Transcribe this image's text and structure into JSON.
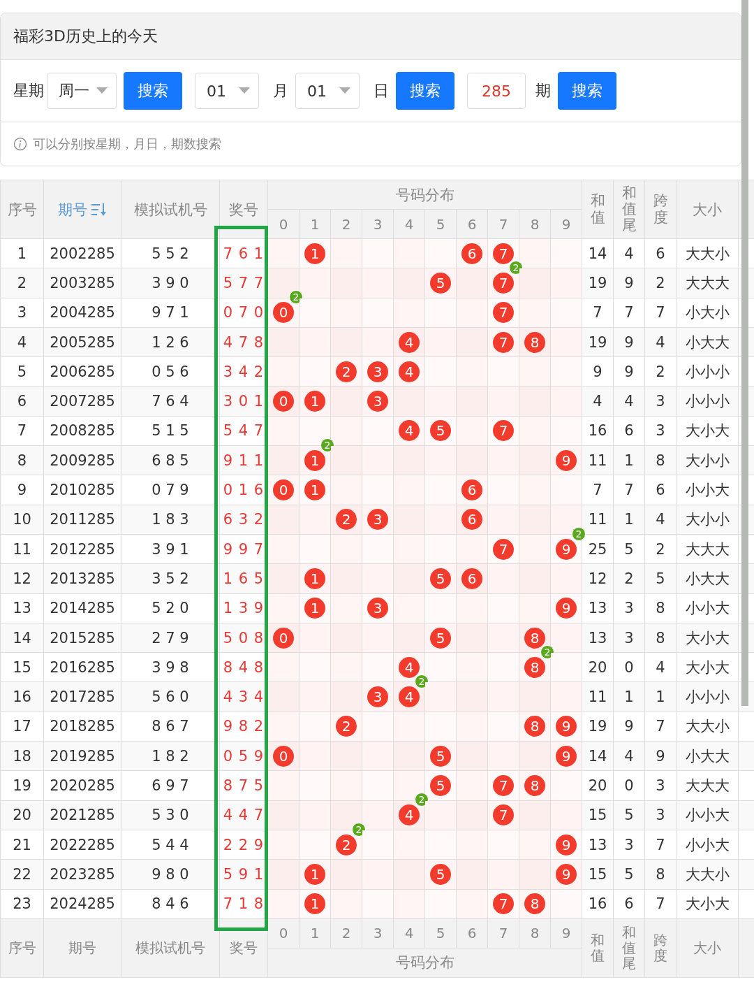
{
  "panel": {
    "title": "福彩3D历史上的今天",
    "search": [
      {
        "kind": "select",
        "label": "星期",
        "value": "周一"
      },
      {
        "kind": "button",
        "text": "搜索"
      },
      {
        "kind": "select",
        "value": "01"
      },
      {
        "kind": "label",
        "label": "月"
      },
      {
        "kind": "select",
        "value": "01"
      },
      {
        "kind": "label",
        "label": "日"
      },
      {
        "kind": "button",
        "text": "搜索"
      },
      {
        "kind": "input",
        "value": "285"
      },
      {
        "kind": "label",
        "label": "期"
      },
      {
        "kind": "button",
        "text": "搜索"
      }
    ],
    "hint": "可以分别按星期，月日，期数搜索"
  },
  "table": {
    "columns": [
      {
        "label": "序号",
        "sorted": false
      },
      {
        "label": "期号",
        "sorted": true
      },
      {
        "label": "模拟试机号",
        "sorted": false
      },
      {
        "label": "奖号",
        "sorted": false
      },
      {
        "label": "号码分布",
        "sorted": false
      },
      {
        "label": "和值",
        "sorted": false
      },
      {
        "label": "和值尾",
        "sorted": false
      },
      {
        "label": "跨度",
        "sorted": false
      },
      {
        "label": "大小",
        "sorted": false
      }
    ],
    "digits": [
      "0",
      "1",
      "2",
      "3",
      "4",
      "5",
      "6",
      "7",
      "8",
      "9"
    ],
    "rows": [
      {
        "no": "1",
        "issue": "2002285",
        "trial": "5 5 2",
        "prize": "7 6 1",
        "dist": [
          {
            "hit": false
          },
          {
            "hit": true,
            "ball": "1"
          },
          {
            "hit": false
          },
          {
            "hit": false
          },
          {
            "hit": false
          },
          {
            "hit": false
          },
          {
            "hit": true,
            "ball": "6"
          },
          {
            "hit": true,
            "ball": "7"
          },
          {
            "hit": false
          },
          {
            "hit": false
          }
        ],
        "sum": "14",
        "tail": "4",
        "span": "6",
        "size": "大大小"
      },
      {
        "no": "2",
        "issue": "2003285",
        "trial": "3 9 0",
        "prize": "5 7 7",
        "dist": [
          {
            "hit": false
          },
          {
            "hit": false
          },
          {
            "hit": false
          },
          {
            "hit": false
          },
          {
            "hit": false
          },
          {
            "hit": true,
            "ball": "5"
          },
          {
            "hit": false
          },
          {
            "hit": true,
            "ball": "7",
            "repeat": "2"
          },
          {
            "hit": false
          },
          {
            "hit": false
          }
        ],
        "sum": "19",
        "tail": "9",
        "span": "2",
        "size": "大大大"
      },
      {
        "no": "3",
        "issue": "2004285",
        "trial": "9 7 1",
        "prize": "0 7 0",
        "dist": [
          {
            "hit": true,
            "ball": "0",
            "repeat": "2"
          },
          {
            "hit": false
          },
          {
            "hit": false
          },
          {
            "hit": false
          },
          {
            "hit": false
          },
          {
            "hit": false
          },
          {
            "hit": false
          },
          {
            "hit": true,
            "ball": "7"
          },
          {
            "hit": false
          },
          {
            "hit": false
          }
        ],
        "sum": "7",
        "tail": "7",
        "span": "7",
        "size": "小大小"
      },
      {
        "no": "4",
        "issue": "2005285",
        "trial": "1 2 6",
        "prize": "4 7 8",
        "dist": [
          {
            "hit": false
          },
          {
            "hit": false
          },
          {
            "hit": false
          },
          {
            "hit": false
          },
          {
            "hit": true,
            "ball": "4"
          },
          {
            "hit": false
          },
          {
            "hit": false
          },
          {
            "hit": true,
            "ball": "7"
          },
          {
            "hit": true,
            "ball": "8"
          },
          {
            "hit": false
          }
        ],
        "sum": "19",
        "tail": "9",
        "span": "4",
        "size": "小大大"
      },
      {
        "no": "5",
        "issue": "2006285",
        "trial": "0 5 6",
        "prize": "3 4 2",
        "dist": [
          {
            "hit": false
          },
          {
            "hit": false
          },
          {
            "hit": true,
            "ball": "2"
          },
          {
            "hit": true,
            "ball": "3"
          },
          {
            "hit": true,
            "ball": "4"
          },
          {
            "hit": false
          },
          {
            "hit": false
          },
          {
            "hit": false
          },
          {
            "hit": false
          },
          {
            "hit": false
          }
        ],
        "sum": "9",
        "tail": "9",
        "span": "2",
        "size": "小小小"
      },
      {
        "no": "6",
        "issue": "2007285",
        "trial": "7 6 4",
        "prize": "3 0 1",
        "dist": [
          {
            "hit": true,
            "ball": "0"
          },
          {
            "hit": true,
            "ball": "1"
          },
          {
            "hit": false
          },
          {
            "hit": true,
            "ball": "3"
          },
          {
            "hit": false
          },
          {
            "hit": false
          },
          {
            "hit": false
          },
          {
            "hit": false
          },
          {
            "hit": false
          },
          {
            "hit": false
          }
        ],
        "sum": "4",
        "tail": "4",
        "span": "3",
        "size": "小小小"
      },
      {
        "no": "7",
        "issue": "2008285",
        "trial": "5 1 5",
        "prize": "5 4 7",
        "dist": [
          {
            "hit": false
          },
          {
            "hit": false
          },
          {
            "hit": false
          },
          {
            "hit": false
          },
          {
            "hit": true,
            "ball": "4"
          },
          {
            "hit": true,
            "ball": "5"
          },
          {
            "hit": false
          },
          {
            "hit": true,
            "ball": "7"
          },
          {
            "hit": false
          },
          {
            "hit": false
          }
        ],
        "sum": "16",
        "tail": "6",
        "span": "3",
        "size": "大小大"
      },
      {
        "no": "8",
        "issue": "2009285",
        "trial": "6 8 5",
        "prize": "9 1 1",
        "dist": [
          {
            "hit": false
          },
          {
            "hit": true,
            "ball": "1",
            "repeat": "2"
          },
          {
            "hit": false
          },
          {
            "hit": false
          },
          {
            "hit": false
          },
          {
            "hit": false
          },
          {
            "hit": false
          },
          {
            "hit": false
          },
          {
            "hit": false
          },
          {
            "hit": true,
            "ball": "9"
          }
        ],
        "sum": "11",
        "tail": "1",
        "span": "8",
        "size": "大小小"
      },
      {
        "no": "9",
        "issue": "2010285",
        "trial": "0 7 9",
        "prize": "0 1 6",
        "dist": [
          {
            "hit": true,
            "ball": "0"
          },
          {
            "hit": true,
            "ball": "1"
          },
          {
            "hit": false
          },
          {
            "hit": false
          },
          {
            "hit": false
          },
          {
            "hit": false
          },
          {
            "hit": true,
            "ball": "6"
          },
          {
            "hit": false
          },
          {
            "hit": false
          },
          {
            "hit": false
          }
        ],
        "sum": "7",
        "tail": "7",
        "span": "6",
        "size": "小小大"
      },
      {
        "no": "10",
        "issue": "2011285",
        "trial": "1 8 3",
        "prize": "6 3 2",
        "dist": [
          {
            "hit": false
          },
          {
            "hit": false
          },
          {
            "hit": true,
            "ball": "2"
          },
          {
            "hit": true,
            "ball": "3"
          },
          {
            "hit": false
          },
          {
            "hit": false
          },
          {
            "hit": true,
            "ball": "6"
          },
          {
            "hit": false
          },
          {
            "hit": false
          },
          {
            "hit": false
          }
        ],
        "sum": "11",
        "tail": "1",
        "span": "4",
        "size": "大小小"
      },
      {
        "no": "11",
        "issue": "2012285",
        "trial": "3 9 1",
        "prize": "9 9 7",
        "dist": [
          {
            "hit": false
          },
          {
            "hit": false
          },
          {
            "hit": false
          },
          {
            "hit": false
          },
          {
            "hit": false
          },
          {
            "hit": false
          },
          {
            "hit": false
          },
          {
            "hit": true,
            "ball": "7"
          },
          {
            "hit": false
          },
          {
            "hit": true,
            "ball": "9",
            "repeat": "2"
          }
        ],
        "sum": "25",
        "tail": "5",
        "span": "2",
        "size": "大大大"
      },
      {
        "no": "12",
        "issue": "2013285",
        "trial": "3 5 2",
        "prize": "1 6 5",
        "dist": [
          {
            "hit": false
          },
          {
            "hit": true,
            "ball": "1"
          },
          {
            "hit": false
          },
          {
            "hit": false
          },
          {
            "hit": false
          },
          {
            "hit": true,
            "ball": "5"
          },
          {
            "hit": true,
            "ball": "6"
          },
          {
            "hit": false
          },
          {
            "hit": false
          },
          {
            "hit": false
          }
        ],
        "sum": "12",
        "tail": "2",
        "span": "5",
        "size": "小大大"
      },
      {
        "no": "13",
        "issue": "2014285",
        "trial": "5 2 0",
        "prize": "1 3 9",
        "dist": [
          {
            "hit": false
          },
          {
            "hit": true,
            "ball": "1"
          },
          {
            "hit": false
          },
          {
            "hit": true,
            "ball": "3"
          },
          {
            "hit": false
          },
          {
            "hit": false
          },
          {
            "hit": false
          },
          {
            "hit": false
          },
          {
            "hit": false
          },
          {
            "hit": true,
            "ball": "9"
          }
        ],
        "sum": "13",
        "tail": "3",
        "span": "8",
        "size": "小小大"
      },
      {
        "no": "14",
        "issue": "2015285",
        "trial": "2 7 9",
        "prize": "5 0 8",
        "dist": [
          {
            "hit": true,
            "ball": "0"
          },
          {
            "hit": false
          },
          {
            "hit": false
          },
          {
            "hit": false
          },
          {
            "hit": false
          },
          {
            "hit": true,
            "ball": "5"
          },
          {
            "hit": false
          },
          {
            "hit": false
          },
          {
            "hit": true,
            "ball": "8"
          },
          {
            "hit": false
          }
        ],
        "sum": "13",
        "tail": "3",
        "span": "8",
        "size": "大小大"
      },
      {
        "no": "15",
        "issue": "2016285",
        "trial": "3 9 8",
        "prize": "8 4 8",
        "dist": [
          {
            "hit": false
          },
          {
            "hit": false
          },
          {
            "hit": false
          },
          {
            "hit": false
          },
          {
            "hit": true,
            "ball": "4"
          },
          {
            "hit": false
          },
          {
            "hit": false
          },
          {
            "hit": false
          },
          {
            "hit": true,
            "ball": "8",
            "repeat": "2"
          },
          {
            "hit": false
          }
        ],
        "sum": "20",
        "tail": "0",
        "span": "4",
        "size": "大小大"
      },
      {
        "no": "16",
        "issue": "2017285",
        "trial": "5 6 0",
        "prize": "4 3 4",
        "dist": [
          {
            "hit": false
          },
          {
            "hit": false
          },
          {
            "hit": false
          },
          {
            "hit": true,
            "ball": "3"
          },
          {
            "hit": true,
            "ball": "4",
            "repeat": "2"
          },
          {
            "hit": false
          },
          {
            "hit": false
          },
          {
            "hit": false
          },
          {
            "hit": false
          },
          {
            "hit": false
          }
        ],
        "sum": "11",
        "tail": "1",
        "span": "1",
        "size": "小小小"
      },
      {
        "no": "17",
        "issue": "2018285",
        "trial": "8 6 7",
        "prize": "9 8 2",
        "dist": [
          {
            "hit": false
          },
          {
            "hit": false
          },
          {
            "hit": true,
            "ball": "2"
          },
          {
            "hit": false
          },
          {
            "hit": false
          },
          {
            "hit": false
          },
          {
            "hit": false
          },
          {
            "hit": false
          },
          {
            "hit": true,
            "ball": "8"
          },
          {
            "hit": true,
            "ball": "9"
          }
        ],
        "sum": "19",
        "tail": "9",
        "span": "7",
        "size": "大大小"
      },
      {
        "no": "18",
        "issue": "2019285",
        "trial": "1 8 2",
        "prize": "0 5 9",
        "dist": [
          {
            "hit": true,
            "ball": "0"
          },
          {
            "hit": false
          },
          {
            "hit": false
          },
          {
            "hit": false
          },
          {
            "hit": false
          },
          {
            "hit": true,
            "ball": "5"
          },
          {
            "hit": false
          },
          {
            "hit": false
          },
          {
            "hit": false
          },
          {
            "hit": true,
            "ball": "9"
          }
        ],
        "sum": "14",
        "tail": "4",
        "span": "9",
        "size": "小大大"
      },
      {
        "no": "19",
        "issue": "2020285",
        "trial": "6 9 7",
        "prize": "8 7 5",
        "dist": [
          {
            "hit": false
          },
          {
            "hit": false
          },
          {
            "hit": false
          },
          {
            "hit": false
          },
          {
            "hit": false
          },
          {
            "hit": true,
            "ball": "5"
          },
          {
            "hit": false
          },
          {
            "hit": true,
            "ball": "7"
          },
          {
            "hit": true,
            "ball": "8"
          },
          {
            "hit": false
          }
        ],
        "sum": "20",
        "tail": "0",
        "span": "3",
        "size": "大大大"
      },
      {
        "no": "20",
        "issue": "2021285",
        "trial": "5 3 0",
        "prize": "4 4 7",
        "dist": [
          {
            "hit": false
          },
          {
            "hit": false
          },
          {
            "hit": false
          },
          {
            "hit": false
          },
          {
            "hit": true,
            "ball": "4",
            "repeat": "2"
          },
          {
            "hit": false
          },
          {
            "hit": false
          },
          {
            "hit": true,
            "ball": "7"
          },
          {
            "hit": false
          },
          {
            "hit": false
          }
        ],
        "sum": "15",
        "tail": "5",
        "span": "3",
        "size": "小小大"
      },
      {
        "no": "21",
        "issue": "2022285",
        "trial": "5 4 4",
        "prize": "2 2 9",
        "dist": [
          {
            "hit": false
          },
          {
            "hit": false
          },
          {
            "hit": true,
            "ball": "2",
            "repeat": "2"
          },
          {
            "hit": false
          },
          {
            "hit": false
          },
          {
            "hit": false
          },
          {
            "hit": false
          },
          {
            "hit": false
          },
          {
            "hit": false
          },
          {
            "hit": true,
            "ball": "9"
          }
        ],
        "sum": "13",
        "tail": "3",
        "span": "7",
        "size": "小小大"
      },
      {
        "no": "22",
        "issue": "2023285",
        "trial": "9 8 0",
        "prize": "5 9 1",
        "dist": [
          {
            "hit": false
          },
          {
            "hit": true,
            "ball": "1"
          },
          {
            "hit": false
          },
          {
            "hit": false
          },
          {
            "hit": false
          },
          {
            "hit": true,
            "ball": "5"
          },
          {
            "hit": false
          },
          {
            "hit": false
          },
          {
            "hit": false
          },
          {
            "hit": true,
            "ball": "9"
          }
        ],
        "sum": "15",
        "tail": "5",
        "span": "8",
        "size": "大大小"
      },
      {
        "no": "23",
        "issue": "2024285",
        "trial": "8 4 6",
        "prize": "7 1 8",
        "dist": [
          {
            "hit": false
          },
          {
            "hit": true,
            "ball": "1"
          },
          {
            "hit": false
          },
          {
            "hit": false
          },
          {
            "hit": false
          },
          {
            "hit": false
          },
          {
            "hit": false
          },
          {
            "hit": true,
            "ball": "7"
          },
          {
            "hit": true,
            "ball": "8"
          },
          {
            "hit": false
          }
        ],
        "sum": "16",
        "tail": "6",
        "span": "7",
        "size": "大小大"
      }
    ],
    "footer": {
      "columns": [
        "序号",
        "期号",
        "模拟试机号",
        "奖号",
        "号码分布",
        "和值",
        "和值尾",
        "跨度",
        "大小"
      ],
      "digits": [
        "0",
        "1",
        "2",
        "3",
        "4",
        "5",
        "6",
        "7",
        "8",
        "9"
      ]
    }
  }
}
